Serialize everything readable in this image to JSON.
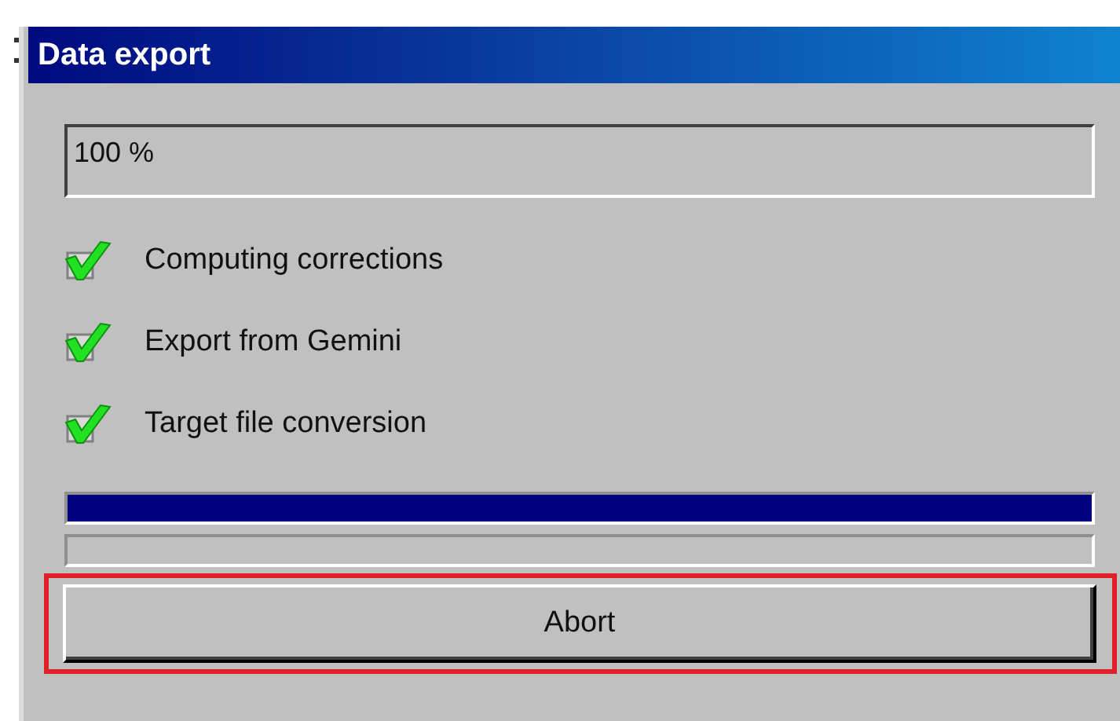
{
  "window": {
    "title": "Data export"
  },
  "status": {
    "value": "100 %"
  },
  "steps": [
    {
      "label": "Computing corrections",
      "checked": true
    },
    {
      "label": "Export from Gemini",
      "checked": true
    },
    {
      "label": "Target file conversion",
      "checked": true
    }
  ],
  "progress_bar": {
    "level": 1
  },
  "abort_button": {
    "label": "Abort",
    "highlighted": true
  }
}
